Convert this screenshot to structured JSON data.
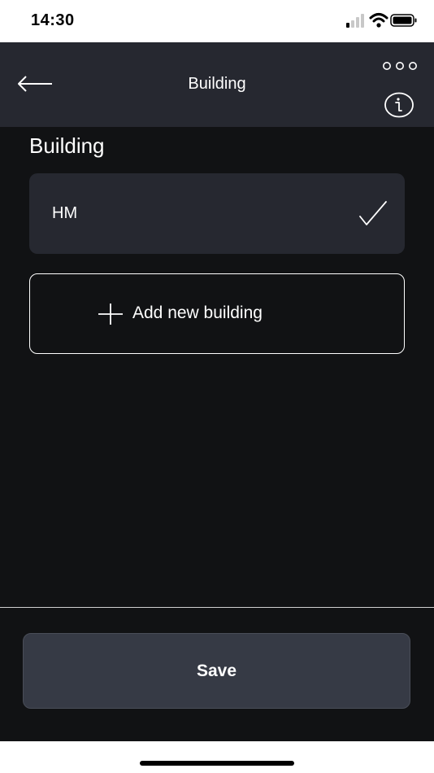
{
  "status_bar": {
    "time": "14:30",
    "icons": [
      "cellular-signal-icon",
      "wifi-icon",
      "battery-icon"
    ]
  },
  "nav": {
    "title": "Building",
    "back_icon": "arrow-left-icon",
    "more_icon": "more-horizontal-icon",
    "info_icon": "info-icon"
  },
  "section": {
    "title": "Building"
  },
  "buildings": [
    {
      "name": "HM",
      "selected": true
    }
  ],
  "add_building": {
    "label": "Add new building",
    "icon": "plus-icon"
  },
  "footer": {
    "save_label": "Save"
  },
  "colors": {
    "nav_background": "#262830",
    "content_background": "#111214",
    "card_background": "#262830",
    "save_button_background": "#363a45",
    "text": "#ffffff"
  }
}
